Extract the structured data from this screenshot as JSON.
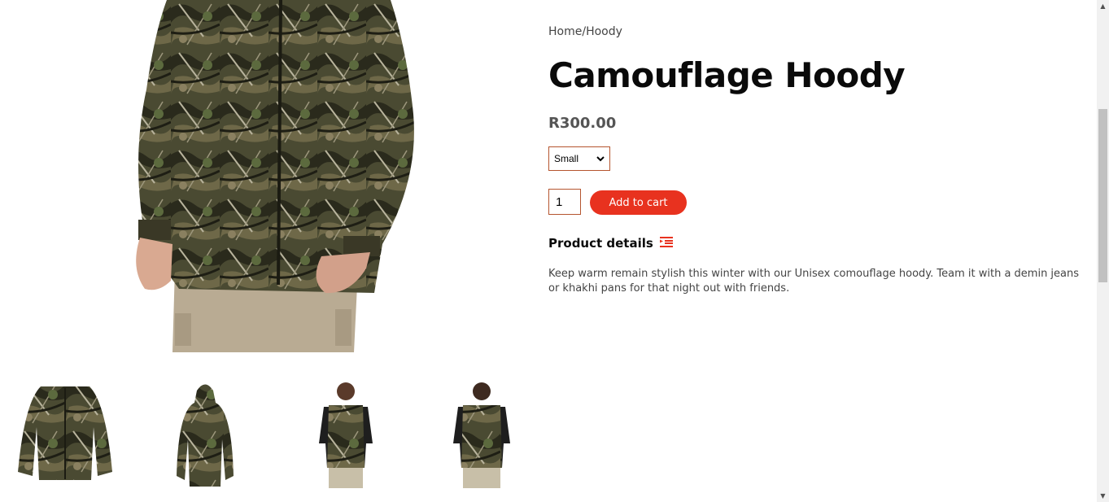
{
  "breadcrumb": {
    "home": "Home",
    "separator": "/",
    "category": "Hoody"
  },
  "product": {
    "title": "Camouflage Hoody",
    "price": "R300.00",
    "size_selected": "Small",
    "quantity": "1",
    "add_to_cart_label": "Add to cart",
    "details_heading": "Product details",
    "details_icon": "list-indent-icon",
    "description": "Keep warm remain stylish this winter with our Unisex comouflage hoody. Team it with a demin jeans or khakhi pans for that night out with friends."
  },
  "colors": {
    "accent": "#e8321f",
    "input_border": "#b5552f",
    "title": "#0a0a0a",
    "text": "#444444"
  },
  "images": {
    "main": "camouflage-hoody-front-closeup",
    "thumbnails": [
      "hoody-front-flat",
      "hoody-back-hooded",
      "vest-model-front",
      "vest-model-back"
    ]
  }
}
